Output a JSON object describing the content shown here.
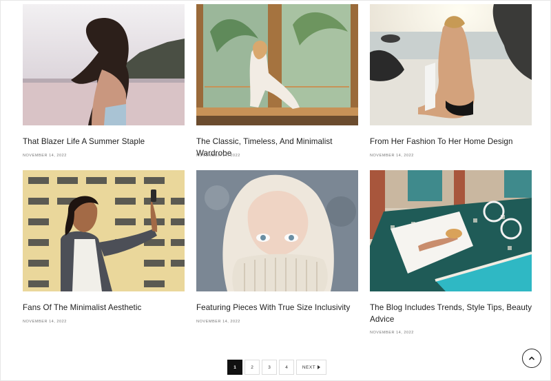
{
  "posts": [
    {
      "title": "That Blazer Life A Summer Staple",
      "date": "NOVEMBER 14, 2022"
    },
    {
      "title": "The Classic, Timeless, And Minimalist Wardrobe",
      "date": "NOVEMBER 14, 2022"
    },
    {
      "title": "From Her Fashion To Her Home Design",
      "date": "NOVEMBER 14, 2022"
    },
    {
      "title": "Fans Of The Minimalist Aesthetic",
      "date": "NOVEMBER 14, 2022"
    },
    {
      "title": "Featuring Pieces With True Size Inclusivity",
      "date": "NOVEMBER 14, 2022"
    },
    {
      "title": "The Blog Includes Trends, Style Tips, Beauty Advice",
      "date": "NOVEMBER 14, 2022"
    }
  ],
  "pagination": {
    "pages": [
      "1",
      "2",
      "3",
      "4"
    ],
    "current": "1",
    "next_label": "NEXT"
  },
  "icons": {
    "next": "chevron-right-icon",
    "scroll_top": "chevron-up-icon"
  }
}
